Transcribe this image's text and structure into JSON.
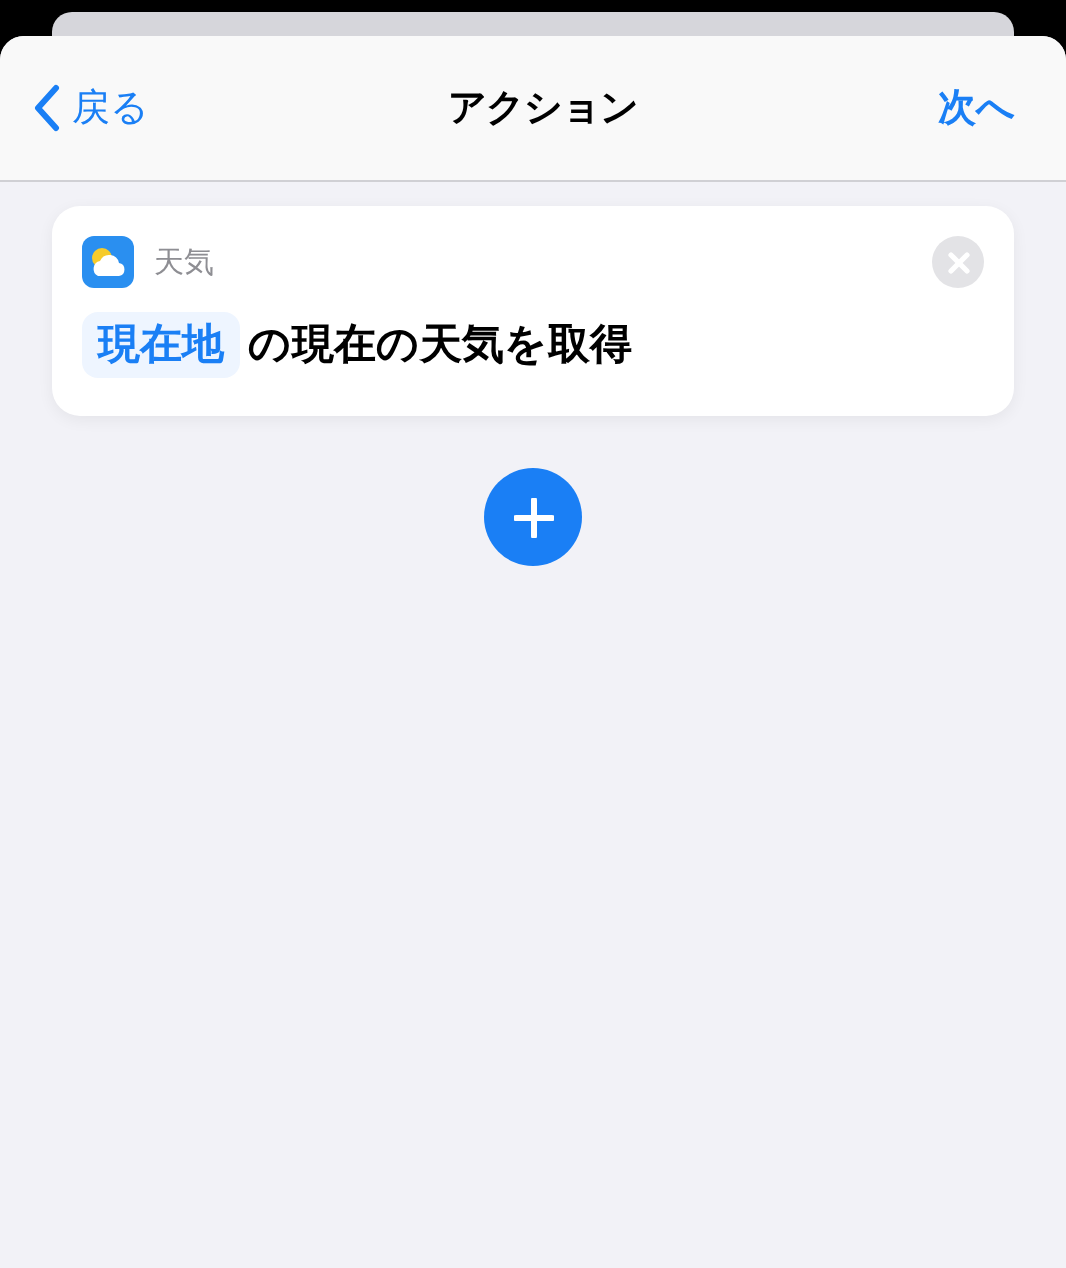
{
  "nav_bar": {
    "back": "戻る",
    "title": "アクション",
    "next": "次へ"
  },
  "action": {
    "app": "天気",
    "parameter": "現在地",
    "text": "の現在の天気を取得"
  }
}
